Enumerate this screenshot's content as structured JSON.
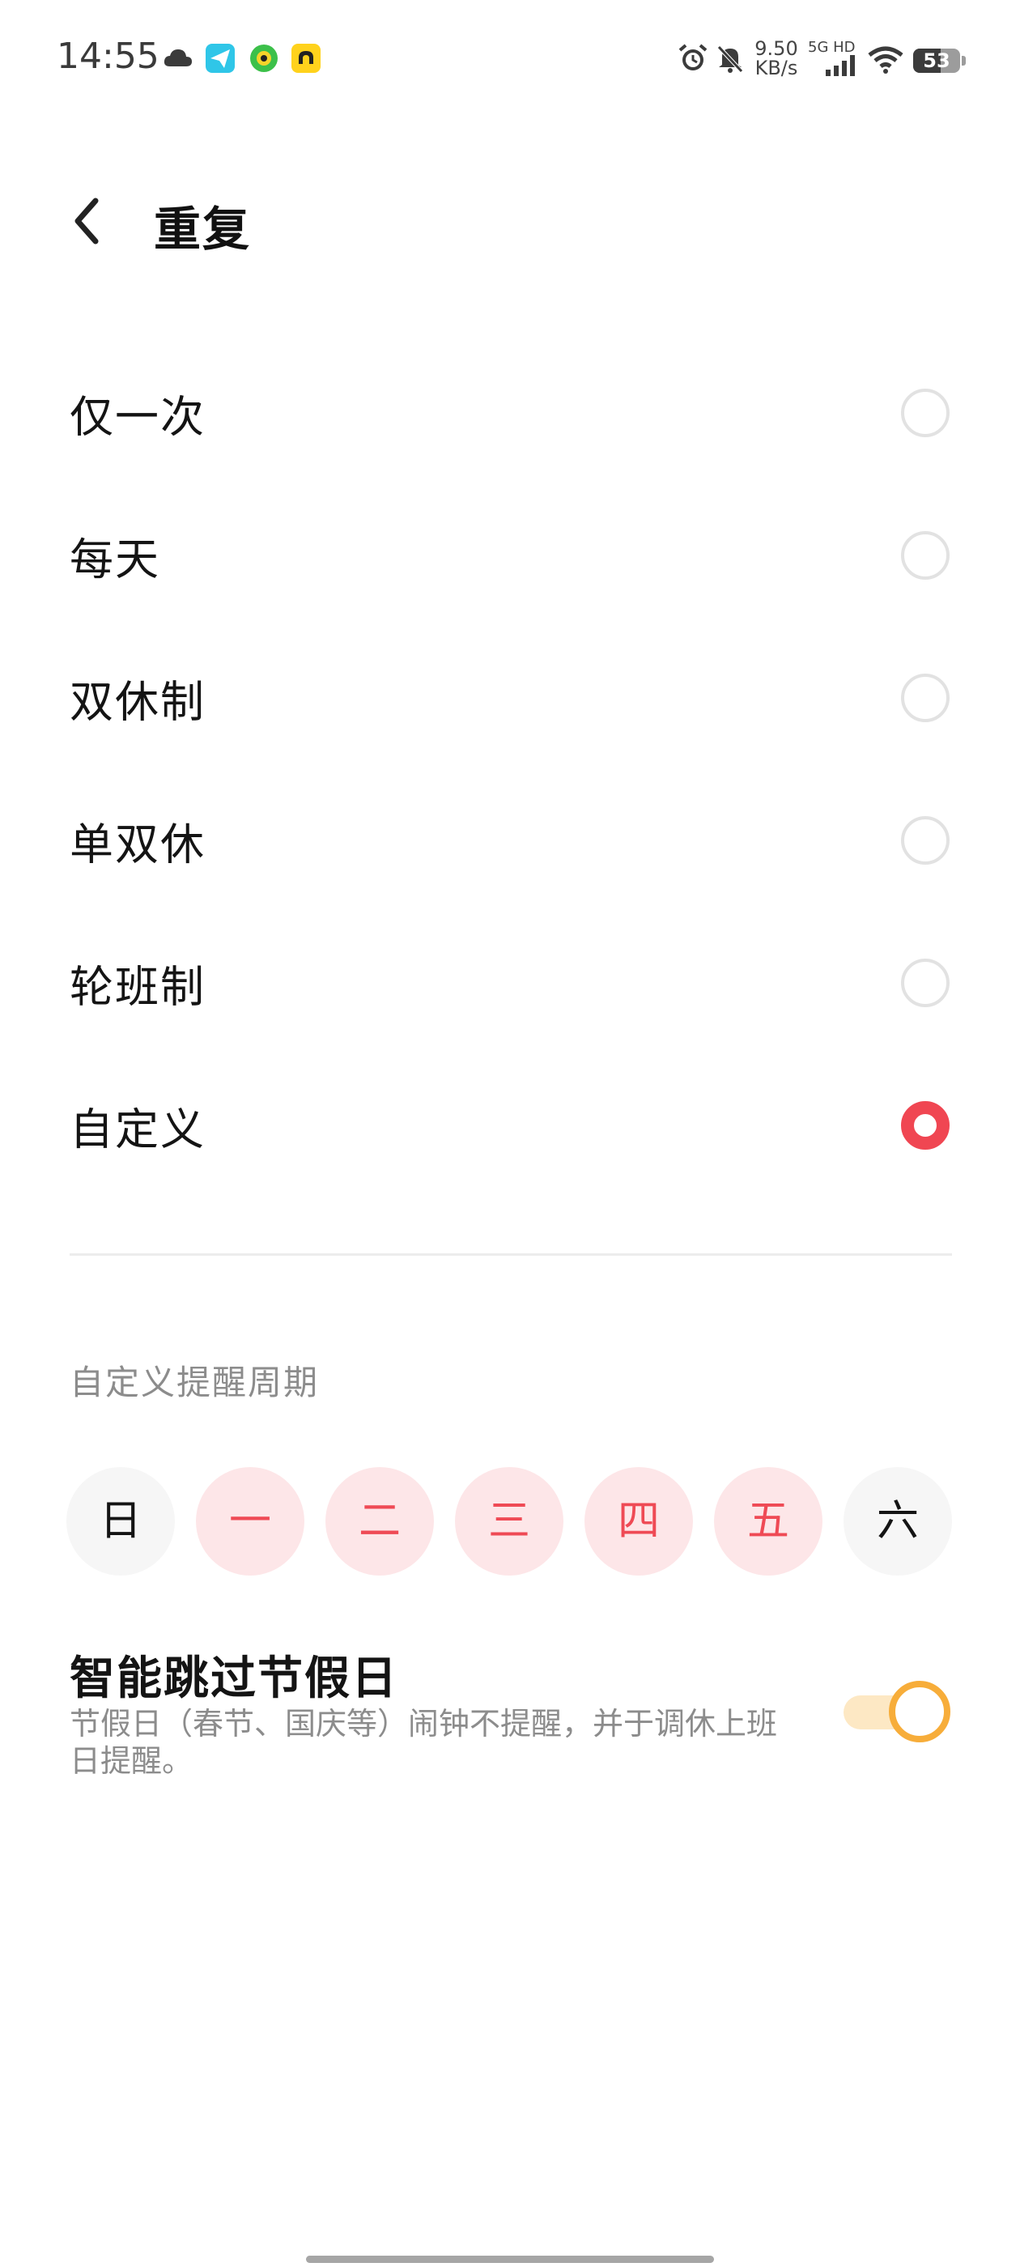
{
  "status_bar": {
    "time": "14:55",
    "left_icons": [
      "cloud-icon",
      "paper-plane-app-icon",
      "green-app-icon",
      "yellow-app-icon"
    ],
    "net_speed_value": "9.50",
    "net_speed_unit": "KB/s",
    "signal_label": "5G HD",
    "battery_level": "53",
    "right_icons": [
      "alarm-icon",
      "mute-bell-icon",
      "signal-icon",
      "wifi-icon",
      "battery-icon"
    ]
  },
  "header": {
    "title": "重复",
    "back_icon": "chevron-left-icon"
  },
  "repeat_options": [
    {
      "label": "仅一次",
      "selected": false
    },
    {
      "label": "每天",
      "selected": false
    },
    {
      "label": "双休制",
      "selected": false
    },
    {
      "label": "单双休",
      "selected": false
    },
    {
      "label": "轮班制",
      "selected": false
    },
    {
      "label": "自定义",
      "selected": true
    }
  ],
  "custom_section": {
    "title": "自定义提醒周期",
    "days": [
      {
        "label": "日",
        "selected": false
      },
      {
        "label": "一",
        "selected": true
      },
      {
        "label": "二",
        "selected": true
      },
      {
        "label": "三",
        "selected": true
      },
      {
        "label": "四",
        "selected": true
      },
      {
        "label": "五",
        "selected": true
      },
      {
        "label": "六",
        "selected": false
      }
    ]
  },
  "skip_holidays": {
    "title": "智能跳过节假日",
    "description": "节假日（春节、国庆等）闹钟不提醒，并于调休上班日提醒。",
    "enabled": true
  },
  "colors": {
    "accent_red": "#f04652",
    "day_selected_bg": "#fde6e8",
    "toggle_orange": "#f7ad3a",
    "toggle_track": "#fde8c4"
  }
}
